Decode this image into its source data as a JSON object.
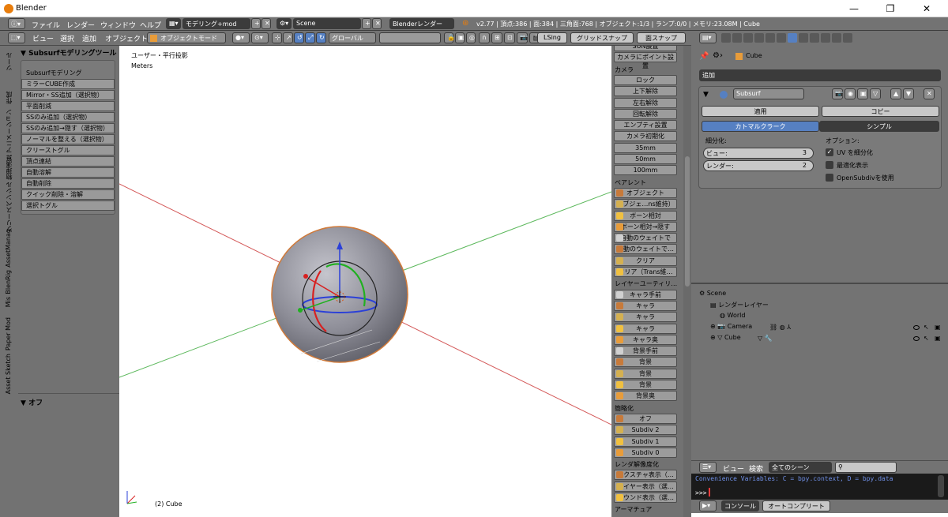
{
  "window": {
    "title": "Blender",
    "minimize": "—",
    "maximize": "❐",
    "close": "✕"
  },
  "info_header": {
    "menus": [
      "ファイル",
      "レンダー",
      "ウィンドウ",
      "ヘルプ"
    ],
    "layout": "モデリング+mod",
    "scene": "Scene",
    "engine": "Blenderレンダー",
    "stats": "v2.77 | 頂点:386 | 面:384 | 三角面:768 | オブジェクト:1/3 | ランプ:0/0 | メモリ:23.08M | Cube"
  },
  "view3d_header": {
    "menus": [
      "ビュー",
      "選択",
      "追加",
      "オブジェクト"
    ],
    "mode": "オブジェクトモード",
    "orientation": "グローバル",
    "lsing": "LSing",
    "grid_snap": "グリッドスナップ",
    "face_snap": "面スナップ"
  },
  "left_tabs": [
    "ツール",
    "作成",
    "アニメーション",
    "物理演算",
    "グリースペンシル",
    "AssetManag",
    "BlenRig",
    "Mis",
    "Paper Mod",
    "Asset Sketch"
  ],
  "toolshelf": {
    "panel_title": "Subsurfモデリングツール",
    "section": "Subsurfモデリング",
    "buttons": [
      "ミラーCUBE作成",
      "Mirror・SS追加（選択物）",
      "平面削減",
      "SSのみ追加（選択物）",
      "SSのみ追加→隠す（選択物）",
      "ノーマルを整える（選択物）",
      "クリーストグル",
      "頂点連結",
      "自動溶解",
      "自動削除",
      "クイック削除・溶解",
      "選択トグル"
    ],
    "bottom_panel": "オフ"
  },
  "viewport": {
    "view_name": "ユーザー・平行投影",
    "units": "Meters",
    "object_info": "(2) Cube"
  },
  "npanel": {
    "items": [
      {
        "type": "btn",
        "label": "SUN設置"
      },
      {
        "type": "btn",
        "label": "カメラにポイント設置"
      },
      {
        "type": "head",
        "label": "カメラ"
      },
      {
        "type": "btn",
        "label": "ロック"
      },
      {
        "type": "btn",
        "label": "上下解除"
      },
      {
        "type": "btn",
        "label": "左右解除"
      },
      {
        "type": "btn",
        "label": "回転解除"
      },
      {
        "type": "btn",
        "label": "エンプティ設置"
      },
      {
        "type": "btn",
        "label": "カメラ初期化"
      },
      {
        "type": "btn",
        "label": "35mm"
      },
      {
        "type": "btn",
        "label": "50mm"
      },
      {
        "type": "btn",
        "label": "100mm"
      },
      {
        "type": "head",
        "label": "ペアレント"
      },
      {
        "type": "btn",
        "label": "オブジェクト"
      },
      {
        "type": "btn",
        "label": "オブジェ…ns維持）"
      },
      {
        "type": "btn",
        "label": "ボーン相対"
      },
      {
        "type": "btn",
        "label": "ボーン相対→隠す"
      },
      {
        "type": "btn",
        "label": "自動のウェイトで"
      },
      {
        "type": "btn",
        "label": "自動のウェイトで…"
      },
      {
        "type": "btn",
        "label": "クリア"
      },
      {
        "type": "btn",
        "label": "クリア（Trans維…"
      },
      {
        "type": "head",
        "label": "レイヤーユーティリ…"
      },
      {
        "type": "btn",
        "label": "キャラ手前"
      },
      {
        "type": "btn",
        "label": "キャラ"
      },
      {
        "type": "btn",
        "label": "キャラ"
      },
      {
        "type": "btn",
        "label": "キャラ"
      },
      {
        "type": "btn",
        "label": "キャラ奥"
      },
      {
        "type": "btn",
        "label": "背景手前"
      },
      {
        "type": "btn",
        "label": "背景"
      },
      {
        "type": "btn",
        "label": "背景"
      },
      {
        "type": "btn",
        "label": "背景"
      },
      {
        "type": "btn",
        "label": "背景奥"
      },
      {
        "type": "head",
        "label": "簡略化"
      },
      {
        "type": "btn",
        "label": "オフ"
      },
      {
        "type": "btn",
        "label": "Subdiv 2"
      },
      {
        "type": "btn",
        "label": "Subdiv 1"
      },
      {
        "type": "btn",
        "label": "Subdiv 0"
      },
      {
        "type": "head",
        "label": "レンダ解像度化"
      },
      {
        "type": "btn",
        "label": "テクスチャ表示（…"
      },
      {
        "type": "btn",
        "label": "ワイヤー表示（選…"
      },
      {
        "type": "btn",
        "label": "バウンド表示（選…"
      },
      {
        "type": "head",
        "label": "アーマチュア"
      }
    ]
  },
  "properties": {
    "breadcrumb": "Cube",
    "add_modifier": "追加",
    "modifier_name": "Subsurf",
    "apply": "適用",
    "copy": "コピー",
    "type_catmull": "カトマルクラーク",
    "type_simple": "シンプル",
    "subdiv_label": "細分化:",
    "view_label": "ビュー:",
    "view_value": "3",
    "render_label": "レンダー:",
    "render_value": "2",
    "options_label": "オプション:",
    "opt_uv": "UV を細分化",
    "opt_uv_checked": true,
    "opt_optimal": "最適化表示",
    "opt_opensubdiv": "OpenSubdivを使用"
  },
  "outliner": {
    "rows": [
      {
        "label": "Scene",
        "indent": 0
      },
      {
        "label": "レンダーレイヤー",
        "indent": 1
      },
      {
        "label": "World",
        "indent": 1
      },
      {
        "label": "Camera",
        "indent": 1
      },
      {
        "label": "Cube",
        "indent": 1
      }
    ],
    "header_view": "ビュー",
    "header_search": "検索",
    "header_filter": "全てのシーン"
  },
  "console": {
    "line1": "Convenience Variables: C = bpy.context, D = bpy.data",
    "prompt": ">>> ",
    "tab_console": "コンソール",
    "tab_autocomplete": "オートコンプリート"
  },
  "colors": {
    "panel_bg": "#727272",
    "selected_blue": "#5680c2",
    "x_axis": "#d45a5a",
    "y_axis": "#5cb85c",
    "console_text": "#6f8fe6"
  }
}
